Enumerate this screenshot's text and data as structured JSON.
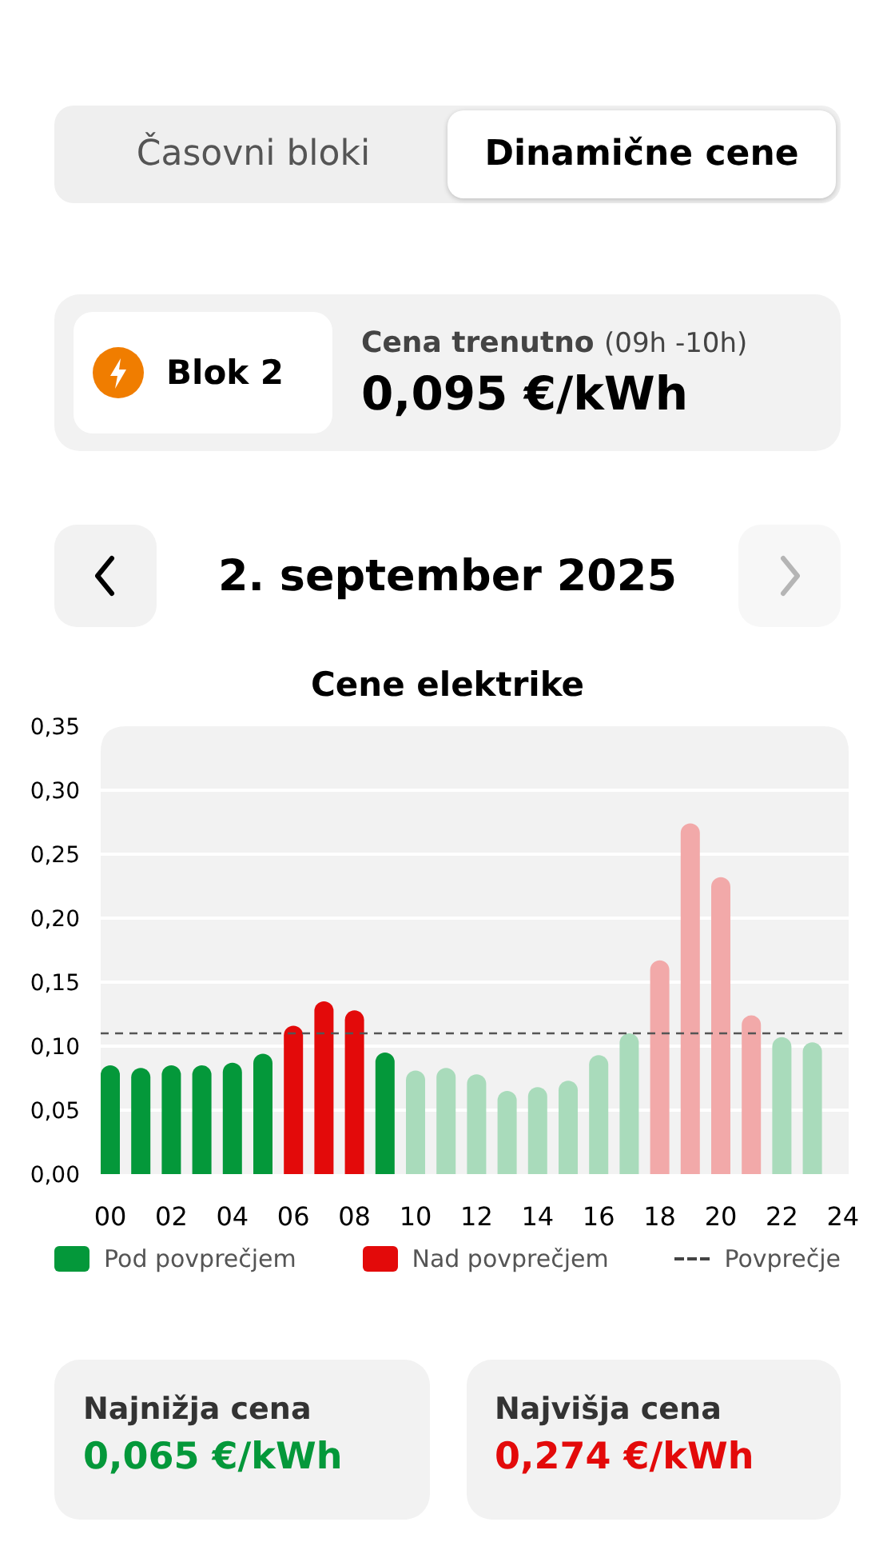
{
  "segmented_control": [
    {
      "label": "Časovni bloki",
      "selected": false
    },
    {
      "label": "Dinamične cene",
      "selected": true
    }
  ],
  "current_price_card": {
    "block_label": "Blok 2",
    "price_label": "Cena trenutno",
    "time_range": "(09h -10h)",
    "price": "0,095 €/kWh"
  },
  "date_navigation": {
    "date": "2. september 2025",
    "previous_disabled": false,
    "next_disabled": true
  },
  "chart": {
    "chart_data": {
      "type": "bar",
      "title": "Cene elektrike",
      "grid": true,
      "xlim": [
        0,
        24
      ],
      "x": [
        0,
        1,
        2,
        3,
        4,
        5,
        6,
        7,
        8,
        9,
        10,
        11,
        12,
        13,
        14,
        15,
        16,
        17,
        18,
        19,
        20,
        21,
        22,
        23
      ],
      "series": [
        {
          "name": "Pod povprečjem",
          "color": "#04983a",
          "values": [
            0.085,
            0.083,
            0.085,
            0.085,
            0.087,
            0.094,
            null,
            null,
            null,
            0.095,
            null,
            null,
            null,
            null,
            null,
            null,
            null,
            null,
            null,
            null,
            null,
            null,
            null,
            null
          ]
        },
        {
          "name": "Nad povprečjem",
          "color": "#e30a0a",
          "values": [
            null,
            null,
            null,
            null,
            null,
            null,
            0.116,
            0.135,
            0.128,
            null,
            null,
            null,
            null,
            null,
            null,
            null,
            null,
            null,
            null,
            null,
            null,
            null,
            null,
            null
          ]
        },
        {
          "color": "#a9dbbb",
          "values": [
            null,
            null,
            null,
            null,
            null,
            null,
            null,
            null,
            null,
            null,
            0.081,
            0.083,
            0.078,
            0.065,
            0.068,
            0.073,
            0.093,
            0.11,
            null,
            null,
            null,
            null,
            0.107,
            0.103
          ]
        },
        {
          "color": "#f2a9a9",
          "values": [
            null,
            null,
            null,
            null,
            null,
            null,
            null,
            null,
            null,
            null,
            null,
            null,
            null,
            null,
            null,
            null,
            null,
            null,
            0.167,
            0.274,
            0.232,
            0.124,
            null,
            null
          ]
        }
      ],
      "ylim": [
        0,
        0.35
      ],
      "yticks": [
        {
          "value": 0,
          "label": "0,00"
        },
        {
          "value": 0.05,
          "label": "0,05"
        },
        {
          "value": 0.1,
          "label": "0,10"
        },
        {
          "value": 0.15,
          "label": "0,15"
        },
        {
          "value": 0.2,
          "label": "0,20"
        },
        {
          "value": 0.25,
          "label": "0,25"
        },
        {
          "value": 0.3,
          "label": "0,30"
        },
        {
          "value": 0.35,
          "label": "0,35"
        }
      ],
      "xticks": [
        {
          "value": 0,
          "label": "00"
        },
        {
          "value": 2,
          "label": "02"
        },
        {
          "value": 4,
          "label": "04"
        },
        {
          "value": 6,
          "label": "06"
        },
        {
          "value": 8,
          "label": "08"
        },
        {
          "value": 10,
          "label": "10"
        },
        {
          "value": 12,
          "label": "12"
        },
        {
          "value": 14,
          "label": "14"
        },
        {
          "value": 16,
          "label": "16"
        },
        {
          "value": 18,
          "label": "18"
        },
        {
          "value": 20,
          "label": "20"
        },
        {
          "value": 22,
          "label": "22"
        },
        {
          "value": 24,
          "label": "24"
        }
      ],
      "ref_lines": [
        {
          "axis": "y",
          "value": 0.11,
          "label": "Povprečje"
        }
      ]
    }
  },
  "stats": [
    {
      "label": "Najnižja cena",
      "value": "0,065 €/kWh",
      "color": "#04983a"
    },
    {
      "label": "Najvišja cena",
      "value": "0,274 €/kWh",
      "color": "#e30a0a"
    }
  ]
}
